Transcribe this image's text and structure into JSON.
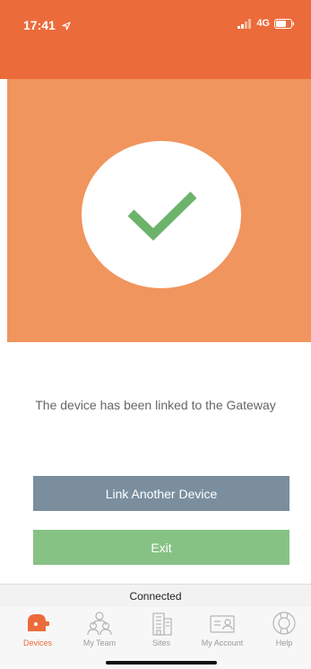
{
  "status_bar": {
    "time": "17:41",
    "network": "4G",
    "location_icon": "location-arrow-icon",
    "signal_icon": "cellular-signal-icon",
    "battery_icon": "battery-icon"
  },
  "hero": {
    "icon": "checkmark-icon"
  },
  "message": "The device has been linked to the Gateway",
  "buttons": {
    "link_another": "Link Another Device",
    "exit": "Exit"
  },
  "connection_status": "Connected",
  "tab_bar": {
    "active": "Devices",
    "items": [
      {
        "label": "Devices",
        "icon": "lock-device-icon"
      },
      {
        "label": "My Team",
        "icon": "team-icon"
      },
      {
        "label": "Sites",
        "icon": "building-icon"
      },
      {
        "label": "My Account",
        "icon": "account-card-icon"
      },
      {
        "label": "Help",
        "icon": "lifebuoy-icon"
      }
    ]
  },
  "colors": {
    "header": "#ec6b3b",
    "hero": "#f0955e",
    "link_button": "#7a8e9e",
    "exit_button": "#87c285",
    "active_tab": "#ec6b3b",
    "inactive_tab": "#9a9a9a"
  }
}
